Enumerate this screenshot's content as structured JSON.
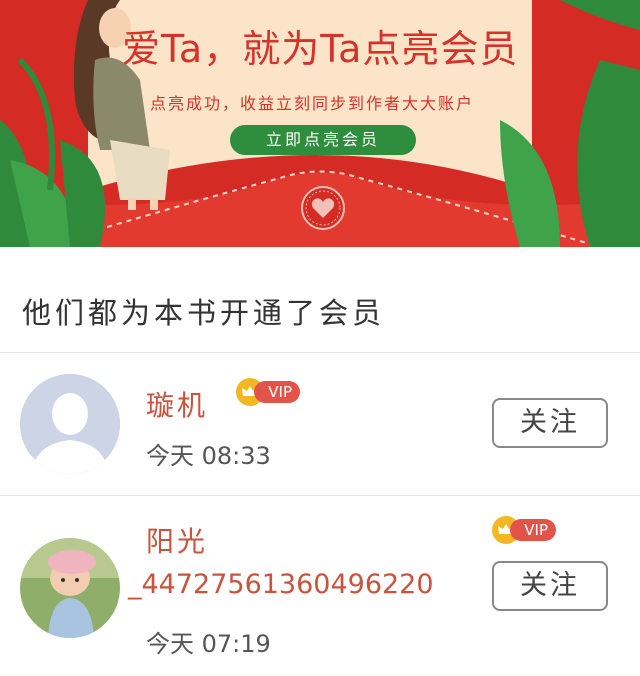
{
  "banner": {
    "title": "爱Ta，就为Ta点亮会员",
    "subtitle": "点亮成功，收益立刻同步到作者大大账户",
    "cta_label": "立即点亮会员",
    "colors": {
      "background": "#d52b25",
      "paper": "#fce4c8",
      "cta": "#2e8e3d",
      "title": "#d4322a"
    }
  },
  "section": {
    "title": "他们都为本书开通了会员"
  },
  "members": [
    {
      "name": "璇机",
      "name_cont": "",
      "time": "今天 08:33",
      "vip_label": "VIP",
      "follow_label": "关注",
      "avatar": "default-person-avatar"
    },
    {
      "name": "阳光",
      "name_cont": "_44727561360496220",
      "time": "今天 07:19",
      "vip_label": "VIP",
      "follow_label": "关注",
      "avatar": "child-photo-avatar"
    }
  ]
}
